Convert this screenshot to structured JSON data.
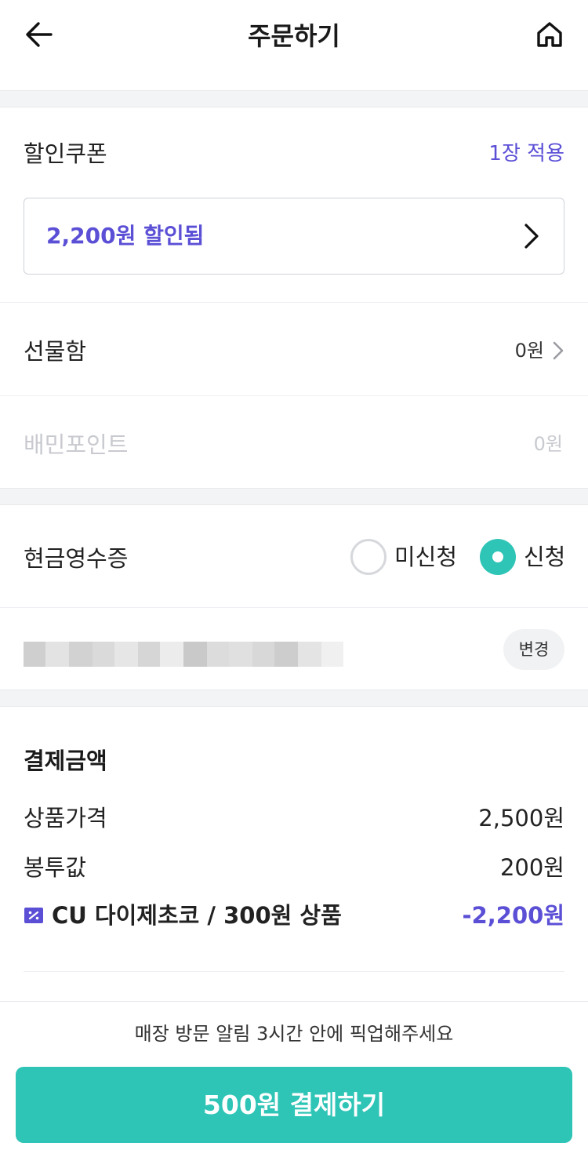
{
  "header": {
    "title": "주문하기",
    "back_icon": "arrow-left-icon",
    "home_icon": "home-icon"
  },
  "coupon": {
    "label": "할인쿠폰",
    "applied": "1장 적용",
    "discount_text": "2,200원 할인됨",
    "chevron_icon": "chevron-right-icon"
  },
  "gift_box": {
    "label": "선물함",
    "value": "0원",
    "chevron_icon": "chevron-right-icon"
  },
  "baemin_point": {
    "label": "배민포인트",
    "value": "0원"
  },
  "cash_receipt": {
    "label": "현금영수증",
    "options": [
      "미신청",
      "신청"
    ],
    "selected": "신청",
    "change_label": "변경"
  },
  "payment": {
    "title": "결제금액",
    "items": [
      {
        "label": "상품가격",
        "value": "2,500원"
      },
      {
        "label": "봉투값",
        "value": "200원"
      },
      {
        "label": "CU 다이제초코 / 300원 상품",
        "value": "-2,200원",
        "icon": "coupon-icon"
      }
    ]
  },
  "footer": {
    "notice": "매장 방문 알림 3시간 안에 픽업해주세요",
    "pay_button": "500원 결제하기"
  },
  "colors": {
    "accent_purple": "#5b4fd6",
    "accent_teal": "#2ec4b6",
    "gap_gray": "#f3f4f6",
    "disabled_text": "#c8cacf"
  }
}
